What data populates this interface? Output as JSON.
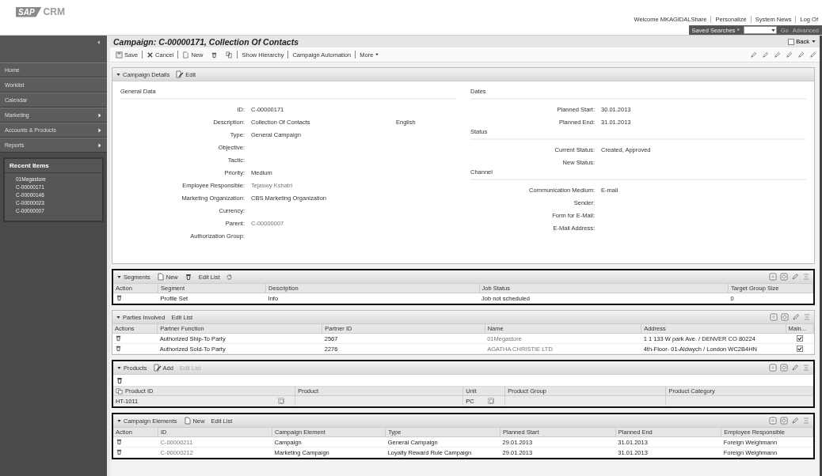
{
  "header": {
    "logo": {
      "mark": "SAP",
      "product": "CRM"
    },
    "links": [
      "Welcome MKAGIDAL",
      "Share",
      "Personalize",
      "System News",
      "Log Of"
    ],
    "saved_searches": {
      "label": "Saved Searches *",
      "go": "Go",
      "advanced": "Advanced",
      "go_disabled": true,
      "advanced_disabled": true
    }
  },
  "sidebar": {
    "items": [
      {
        "label": "Home",
        "has_submenu": false
      },
      {
        "label": "Worklist",
        "has_submenu": false
      },
      {
        "label": "Calendar",
        "has_submenu": false
      },
      {
        "label": "Marketing",
        "has_submenu": true
      },
      {
        "label": "Accounts & Products",
        "has_submenu": true
      },
      {
        "label": "Reports",
        "has_submenu": true
      }
    ],
    "recent": {
      "title": "Recent Items",
      "items": [
        "01Megastore",
        "C-00000171",
        "C-00000146",
        "C-00000023",
        "C-00000007"
      ]
    }
  },
  "page": {
    "title": "Campaign: C-00000171, Collection Of Contacts",
    "back": "Back",
    "toolbar": [
      {
        "kind": "save",
        "label": "Save"
      },
      {
        "kind": "cancel",
        "label": "Cancel"
      },
      {
        "kind": "new",
        "label": "New"
      },
      {
        "kind": "delete"
      },
      {
        "kind": "copy"
      },
      {
        "kind": "text",
        "label": "Show Hierarchy"
      },
      {
        "kind": "text",
        "label": "Campaign Automation"
      },
      {
        "kind": "more",
        "label": "More"
      }
    ]
  },
  "details": {
    "title": "Campaign Details",
    "edit": "Edit",
    "general": {
      "heading": "General Data",
      "fields": [
        {
          "label": "ID:",
          "value": "C-00000171",
          "link": false
        },
        {
          "label": "Description:",
          "value": "Collection Of Contacts",
          "extra": "English",
          "link": false
        },
        {
          "label": "Type:",
          "value": "General Campaign",
          "link": false
        },
        {
          "label": "Objective:"
        },
        {
          "label": "Tactic:"
        },
        {
          "label": "Priority:",
          "value": "Medium",
          "link": false
        },
        {
          "label": "Employee Responsible:",
          "value": "Tejaswy Kshatri",
          "link": true
        },
        {
          "label": "Marketing Organization:",
          "value": "CBS Marketing Organization",
          "link": false
        },
        {
          "label": "Currency:"
        },
        {
          "label": "Parent:",
          "value": "C-00000007",
          "link": true
        },
        {
          "label": "Authorization Group:"
        }
      ]
    },
    "sections": [
      {
        "heading": "Dates",
        "fields": [
          {
            "label": "Planned Start:",
            "value": "30.01.2013"
          },
          {
            "label": "Planned End:",
            "value": "31.01.2013"
          }
        ]
      },
      {
        "heading": "Status",
        "fields": [
          {
            "label": "Current Status:",
            "value": "Created, Approved"
          },
          {
            "label": "New Status:"
          }
        ]
      },
      {
        "heading": "Channel",
        "fields": [
          {
            "label": "Communication Medium:",
            "value": "E-mail"
          },
          {
            "label": "Sender:"
          },
          {
            "label": "Form for E-Mail:"
          },
          {
            "label": "E-Mail Address:"
          }
        ]
      }
    ]
  },
  "tables": [
    {
      "title": "Segments",
      "framed": true,
      "actions": [
        {
          "kind": "new",
          "label": "New"
        },
        {
          "kind": "delete"
        },
        {
          "kind": "edit_list",
          "label": "Edit List"
        },
        {
          "kind": "refresh"
        }
      ],
      "columns": [
        "Action",
        "Segment",
        "Description",
        "Job Status",
        "Target Group Size"
      ],
      "rows": [
        {
          "cells": [
            {
              "delete": true
            },
            "Profile Set",
            "Info",
            "Job not scheduled",
            {
              "text": "0",
              "numeric": true
            }
          ]
        }
      ]
    },
    {
      "title": "Parties Involved",
      "framed": false,
      "actions": [
        {
          "kind": "edit_list",
          "label": "Edit List",
          "disabled": false
        }
      ],
      "columns": [
        "Actions",
        "Partner Function",
        "Partner ID",
        "Name",
        "Address",
        "Main..."
      ],
      "rows": [
        {
          "cells": [
            {
              "delete": true
            },
            "Authorized Ship-To Party",
            "2567",
            {
              "text": "01Megastore",
              "link": true
            },
            "1 1 133 W park Ave. / DENVER CO 80224",
            {
              "checked": true
            }
          ]
        },
        {
          "cells": [
            {
              "delete": true
            },
            "Authorized Sold-To Party",
            "2276",
            {
              "text": "AGATHA CHRISTIE LTD",
              "link": true
            },
            "4th-Floor- 01-Aldwych / London WC2B4HN",
            {
              "checked": true
            }
          ]
        }
      ]
    },
    {
      "title": "Products",
      "framed": true,
      "top_delete": true,
      "select_all": true,
      "actions": [
        {
          "kind": "add",
          "label": "Add",
          "disabled": false
        },
        {
          "kind": "edit_list",
          "label": "Edit List",
          "disabled": true
        }
      ],
      "columns": [
        "Product ID",
        "Product",
        "Unit",
        "Product Group",
        "Product Category"
      ],
      "rows": [
        {
          "input": true,
          "cells": [
            {
              "text": "HT-1011",
              "value_help": true
            },
            {
              "value_help": false
            },
            {
              "text": "PC",
              "value_help": true
            },
            {
              "value_help": false
            },
            {
              "value_help": false
            }
          ]
        }
      ]
    },
    {
      "title": "Campaign Elements",
      "framed": true,
      "actions": [
        {
          "kind": "new",
          "label": "New"
        },
        {
          "kind": "edit_list",
          "label": "Edit List"
        }
      ],
      "columns": [
        "Action",
        "ID",
        "Campaign Element",
        "Type",
        "Planned Start",
        "Planned End",
        "Employee Responsible"
      ],
      "rows": [
        {
          "cells": [
            {
              "delete": true
            },
            {
              "text": "C-00000211",
              "link": true
            },
            "Campaign",
            "General Campaign",
            "29.01.2013",
            "31.01.2013",
            "Foreign Weighmann"
          ]
        },
        {
          "cells": [
            {
              "delete": true
            },
            {
              "text": "C-00000212",
              "link": true
            },
            "Marketing Campaign",
            "Loyalty Reward Rule Campaign",
            "29.01.2013",
            "31.01.2013",
            "Foreign Weighmann"
          ]
        }
      ]
    }
  ]
}
